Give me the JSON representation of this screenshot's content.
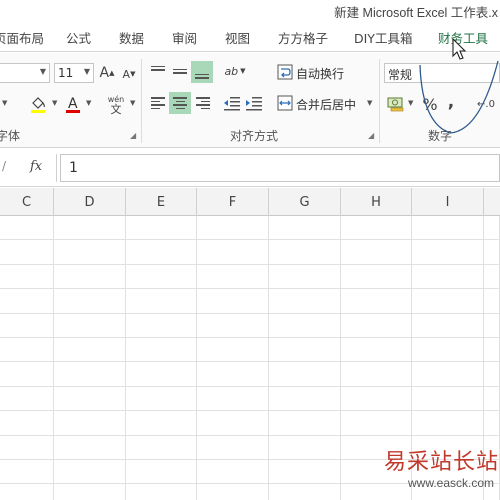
{
  "window": {
    "title": "新建 Microsoft Excel 工作表.x"
  },
  "tabs": [
    "页面布局",
    "公式",
    "数据",
    "审阅",
    "视图",
    "方方格子",
    "DIY工具箱",
    "财务工具"
  ],
  "active_tab": "财务工具",
  "font": {
    "size": "11",
    "grow_label": "A",
    "shrink_label": "A",
    "wen_top": "wén",
    "wen_bottom": "文"
  },
  "alignment": {
    "wrap_text_label": "自动换行",
    "merge_center_label": "合并后居中",
    "orientation_label": "ab"
  },
  "number": {
    "format_value": "常规",
    "percent_label": "%",
    "comma_label": ",",
    "decimal_label": "←.0"
  },
  "groups": {
    "font_label": "字体",
    "alignment_label": "对齐方式",
    "number_label": "数字"
  },
  "formula_bar": {
    "fx_label": "fx",
    "value": "1"
  },
  "columns": [
    "C",
    "D",
    "E",
    "F",
    "G",
    "H",
    "I"
  ],
  "watermark": {
    "title": "易采站长站",
    "url": "www.easck.com"
  },
  "colors": {
    "accent": "#217346",
    "selected_button": "#a9d8b9",
    "watermark": "#c0392b"
  }
}
